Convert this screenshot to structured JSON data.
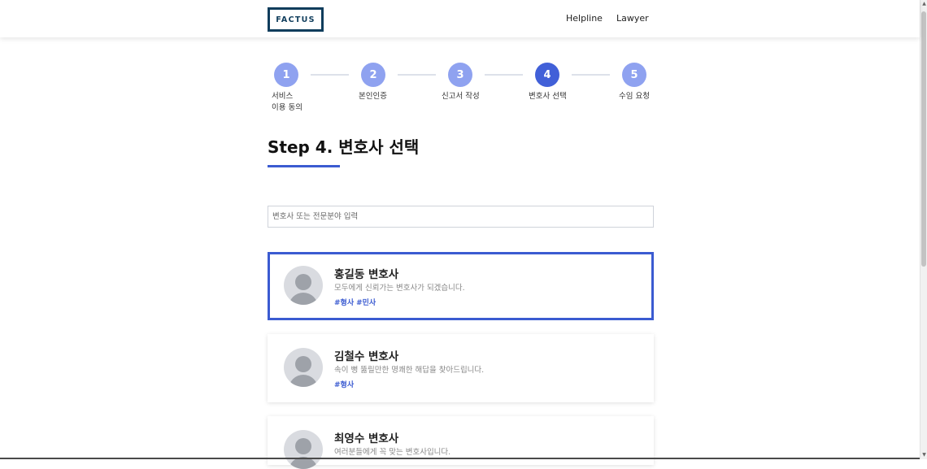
{
  "header": {
    "logo": "FACTUS",
    "nav": [
      "Helpline",
      "Lawyer"
    ]
  },
  "steps": [
    {
      "number": "1",
      "label": "서비스\n이용 동의"
    },
    {
      "number": "2",
      "label": "본인인증"
    },
    {
      "number": "3",
      "label": "신고서 작성"
    },
    {
      "number": "4",
      "label": "변호사 선택",
      "active": true
    },
    {
      "number": "5",
      "label": "수임 요청"
    }
  ],
  "page": {
    "title": "Step 4. 변호사 선택"
  },
  "search": {
    "placeholder": "변호사 또는 전문분야 입력",
    "value": ""
  },
  "lawyers": [
    {
      "name": "홍길동 변호사",
      "description": "모두에게 신뢰가는 변호사가 되겠습니다.",
      "tags": [
        "#형사",
        "#민사"
      ],
      "selected": true
    },
    {
      "name": "김철수 변호사",
      "description": "속이 뻥 뚫릴만한 명쾌한 해답을 찾아드립니다.",
      "tags": [
        "#형사"
      ],
      "selected": false
    },
    {
      "name": "최영수 변호사",
      "description": "여러분들에게 꼭 맞는 변호사입니다.",
      "tags": [],
      "selected": false
    }
  ],
  "colors": {
    "accent": "#3b5bd1",
    "step_active": "#4160d8",
    "step_inactive": "#8fa2f0",
    "logo": "#0f3d5c"
  },
  "icons": {
    "avatar": "user-placeholder-icon",
    "scroll_up": "triangle-up-icon",
    "scroll_down": "triangle-down-icon"
  }
}
